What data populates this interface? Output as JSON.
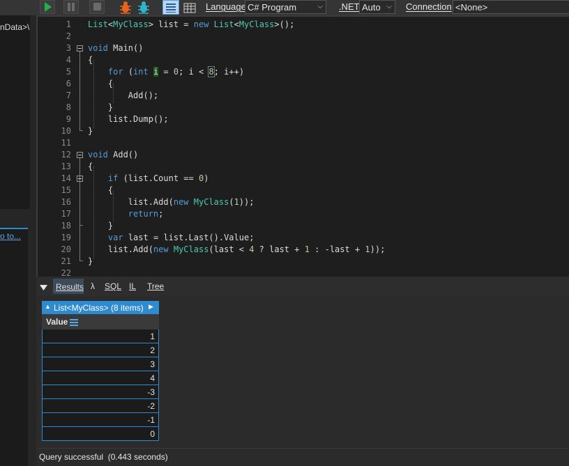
{
  "toolbar": {
    "language_label": "Language",
    "language_value": "C# Program",
    "net_label": ".NET",
    "net_value": "Auto",
    "connection_label": "Connection",
    "connection_value": "<None>"
  },
  "left_panel": {
    "path_fragment": "nData>\\",
    "link_fragment": "o to..."
  },
  "editor": {
    "line_numbers": [
      "1",
      "2",
      "3",
      "4",
      "5",
      "6",
      "7",
      "8",
      "9",
      "10",
      "11",
      "12",
      "13",
      "14",
      "15",
      "16",
      "17",
      "18",
      "19",
      "20",
      "21",
      "22"
    ]
  },
  "results_tabs": {
    "results": "Results",
    "lambda": "λ",
    "sql": "SQL",
    "il": "IL",
    "tree": "Tree"
  },
  "results_table": {
    "header": "List<MyClass> (8 items)",
    "column": "Value",
    "rows": [
      "1",
      "2",
      "3",
      "4",
      "-3",
      "-2",
      "-1",
      "0"
    ]
  },
  "status": {
    "text": "Query successful  (0.443 seconds)"
  },
  "colors": {
    "accent": "#2f8bd0",
    "run": "#22b14c",
    "keyword": "#569cd6",
    "type": "#4ec9b0",
    "number": "#b5cea8"
  }
}
